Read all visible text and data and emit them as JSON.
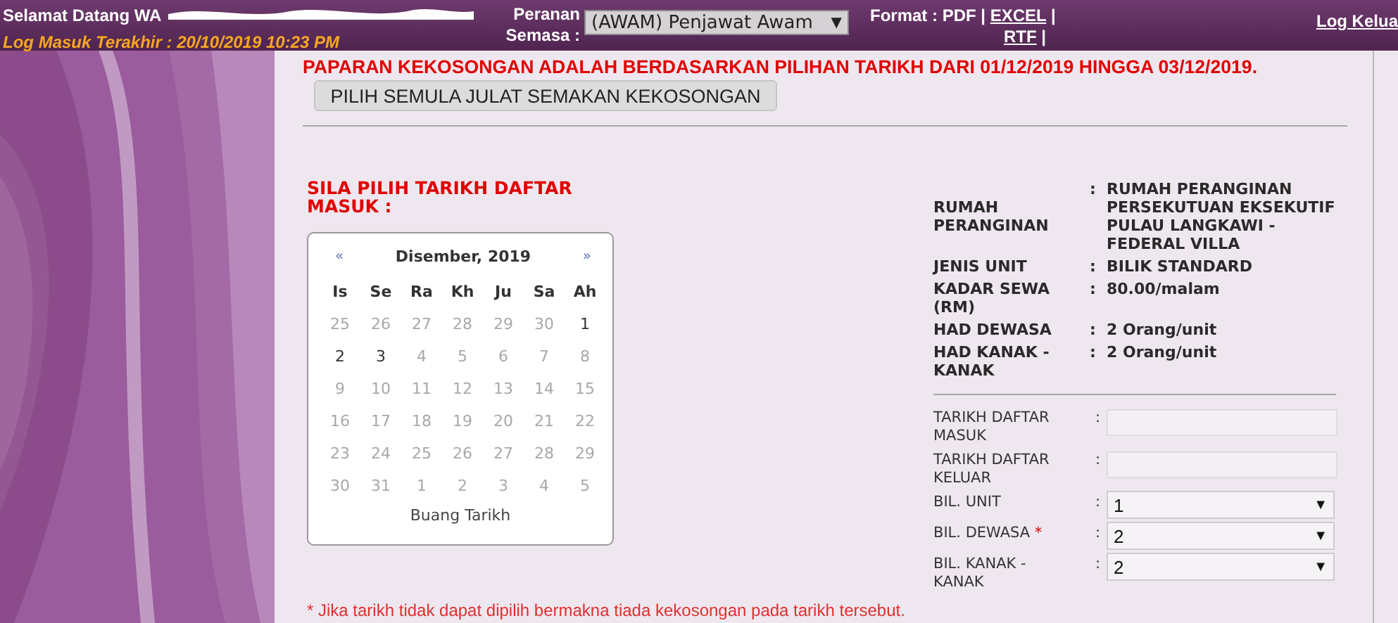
{
  "header": {
    "welcome": "Selamat Datang WA",
    "last_login": "Log Masuk Terakhir : 20/10/2019 10:23 PM",
    "role_label": [
      "Peranan",
      "Semasa :"
    ],
    "role_value": "(AWAM) Penjawat Awam",
    "role_caret": "▼",
    "format_label": "Format : PDF |",
    "format_links": [
      {
        "label": "EXCEL",
        "separator": "|"
      },
      {
        "label": "RTF",
        "separator": "|"
      }
    ],
    "logout": "Log Kelua"
  },
  "notice": "PAPARAN KEKOSONGAN ADALAH BERDASARKAN PILIHAN TARIKH DARI 01/12/2019 HINGGA 03/12/2019.",
  "reselect_button": "PILIH SEMULA JULAT SEMAKAN KEKOSONGAN",
  "calendar_heading": "SILA PILIH TARIKH DAFTAR MASUK :",
  "calendar": {
    "prev": "«",
    "month": "Disember, 2019",
    "next": "»",
    "weekdays": [
      "Is",
      "Se",
      "Ra",
      "Kh",
      "Ju",
      "Sa",
      "Ah"
    ],
    "weeks": [
      [
        {
          "day": "25",
          "available": false
        },
        {
          "day": "26",
          "available": false
        },
        {
          "day": "27",
          "available": false
        },
        {
          "day": "28",
          "available": false
        },
        {
          "day": "29",
          "available": false
        },
        {
          "day": "30",
          "available": false
        },
        {
          "day": "1",
          "available": true
        }
      ],
      [
        {
          "day": "2",
          "available": true
        },
        {
          "day": "3",
          "available": true
        },
        {
          "day": "4",
          "available": false
        },
        {
          "day": "5",
          "available": false
        },
        {
          "day": "6",
          "available": false
        },
        {
          "day": "7",
          "available": false
        },
        {
          "day": "8",
          "available": false
        }
      ],
      [
        {
          "day": "9",
          "available": false
        },
        {
          "day": "10",
          "available": false
        },
        {
          "day": "11",
          "available": false
        },
        {
          "day": "12",
          "available": false
        },
        {
          "day": "13",
          "available": false
        },
        {
          "day": "14",
          "available": false
        },
        {
          "day": "15",
          "available": false
        }
      ],
      [
        {
          "day": "16",
          "available": false
        },
        {
          "day": "17",
          "available": false
        },
        {
          "day": "18",
          "available": false
        },
        {
          "day": "19",
          "available": false
        },
        {
          "day": "20",
          "available": false
        },
        {
          "day": "21",
          "available": false
        },
        {
          "day": "22",
          "available": false
        }
      ],
      [
        {
          "day": "23",
          "available": false
        },
        {
          "day": "24",
          "available": false
        },
        {
          "day": "25",
          "available": false
        },
        {
          "day": "26",
          "available": false
        },
        {
          "day": "27",
          "available": false
        },
        {
          "day": "28",
          "available": false
        },
        {
          "day": "29",
          "available": false
        }
      ],
      [
        {
          "day": "30",
          "available": false
        },
        {
          "day": "31",
          "available": false
        },
        {
          "day": "1",
          "available": false
        },
        {
          "day": "2",
          "available": false
        },
        {
          "day": "3",
          "available": false
        },
        {
          "day": "4",
          "available": false
        },
        {
          "day": "5",
          "available": false
        }
      ]
    ],
    "clear": "Buang Tarikh"
  },
  "details": [
    {
      "label": "RUMAH PERANGINAN",
      "separator": ":",
      "value": "RUMAH PERANGINAN PERSEKUTUAN EKSEKUTIF PULAU LANGKAWI - FEDERAL VILLA"
    },
    {
      "label": "JENIS UNIT",
      "separator": ":",
      "value": "BILIK STANDARD"
    },
    {
      "label": "KADAR SEWA (RM)",
      "separator": ":",
      "value": "80.00/malam"
    },
    {
      "label": "HAD DEWASA",
      "separator": ":",
      "value": "2 Orang/unit"
    },
    {
      "label": "HAD KANAK - KANAK",
      "separator": ":",
      "value": "2 Orang/unit"
    }
  ],
  "form": [
    {
      "kind": "text",
      "label": "TARIKH DAFTAR MASUK",
      "separator": ":",
      "required": false
    },
    {
      "kind": "text",
      "label": "TARIKH DAFTAR KELUAR",
      "separator": ":",
      "required": false
    },
    {
      "kind": "select",
      "label": "BIL. UNIT",
      "separator": ":",
      "required": false,
      "value": "1",
      "caret": "▼"
    },
    {
      "kind": "select",
      "label": "BIL. DEWASA",
      "separator": ":",
      "required": true,
      "required_mark": "*",
      "value": "2",
      "caret": "▼"
    },
    {
      "kind": "select",
      "label": "BIL. KANAK - KANAK",
      "separator": ":",
      "required": false,
      "value": "2",
      "caret": "▼"
    }
  ],
  "footnote": "* Jika tarikh tidak dapat dipilih bermakna tiada kekosongan pada tarikh tersebut."
}
